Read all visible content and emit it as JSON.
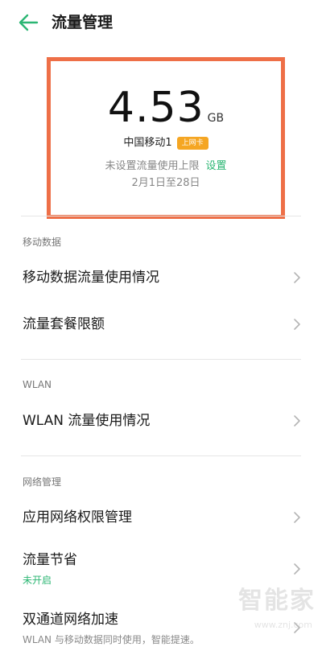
{
  "header": {
    "title": "流量管理"
  },
  "summary": {
    "usage_number": "4.53",
    "usage_unit": "GB",
    "sim_name": "中国移动1",
    "sim_badge": "上网卡",
    "limit_text": "未设置流量使用上限",
    "limit_link": "设置",
    "period": "2月1日至28日"
  },
  "sections": {
    "mobile_data": {
      "header": "移动数据",
      "items": [
        {
          "label": "移动数据流量使用情况"
        },
        {
          "label": "流量套餐限额"
        }
      ]
    },
    "wlan": {
      "header": "WLAN",
      "items": [
        {
          "label": "WLAN 流量使用情况"
        }
      ]
    },
    "network": {
      "header": "网络管理",
      "items": [
        {
          "label": "应用网络权限管理"
        },
        {
          "label": "流量节省",
          "sub": "未开启"
        },
        {
          "label": "双通道网络加速",
          "sub": "WLAN 与移动数据同时使用，智能提速。"
        }
      ]
    }
  },
  "watermark": {
    "text": "智能家",
    "url": "www.znj.com"
  },
  "colors": {
    "accent_green": "#2bb673",
    "highlight_border": "#ee6f47",
    "badge_orange": "#f5a623"
  },
  "icons": {
    "back": "arrow-left-icon",
    "chevron": "chevron-right-icon"
  }
}
